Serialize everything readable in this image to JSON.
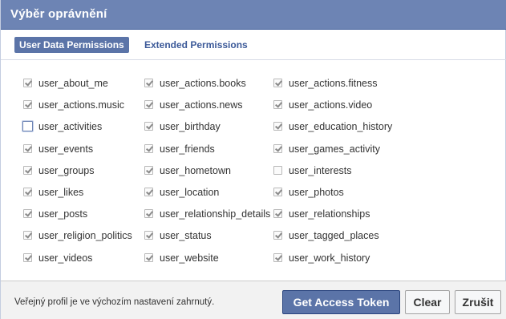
{
  "dialog": {
    "title": "Výběr oprávnění"
  },
  "tabs": [
    {
      "label": "User Data Permissions",
      "active": true
    },
    {
      "label": "Extended Permissions",
      "active": false
    }
  ],
  "permissions": [
    {
      "label": "user_about_me",
      "checked": true
    },
    {
      "label": "user_actions.books",
      "checked": true
    },
    {
      "label": "user_actions.fitness",
      "checked": true
    },
    {
      "label": "user_actions.music",
      "checked": true
    },
    {
      "label": "user_actions.news",
      "checked": true
    },
    {
      "label": "user_actions.video",
      "checked": true
    },
    {
      "label": "user_activities",
      "checked": false
    },
    {
      "label": "user_birthday",
      "checked": true
    },
    {
      "label": "user_education_history",
      "checked": true
    },
    {
      "label": "user_events",
      "checked": true
    },
    {
      "label": "user_friends",
      "checked": true
    },
    {
      "label": "user_games_activity",
      "checked": true
    },
    {
      "label": "user_groups",
      "checked": true
    },
    {
      "label": "user_hometown",
      "checked": true
    },
    {
      "label": "user_interests",
      "checked": false
    },
    {
      "label": "user_likes",
      "checked": true
    },
    {
      "label": "user_location",
      "checked": true
    },
    {
      "label": "user_photos",
      "checked": true
    },
    {
      "label": "user_posts",
      "checked": true
    },
    {
      "label": "user_relationship_details",
      "checked": true
    },
    {
      "label": "user_relationships",
      "checked": true
    },
    {
      "label": "user_religion_politics",
      "checked": true
    },
    {
      "label": "user_status",
      "checked": true
    },
    {
      "label": "user_tagged_places",
      "checked": true
    },
    {
      "label": "user_videos",
      "checked": true
    },
    {
      "label": "user_website",
      "checked": true
    },
    {
      "label": "user_work_history",
      "checked": true
    }
  ],
  "footer": {
    "note": "Veřejný profil je ve výchozím nastavení zahrnutý.",
    "get_token_label": "Get Access Token",
    "clear_label": "Clear",
    "cancel_label": "Zrušit"
  },
  "colors": {
    "header_bg": "#6d84b4",
    "primary_button": "#5b74a8",
    "tab_link": "#3b5998"
  }
}
